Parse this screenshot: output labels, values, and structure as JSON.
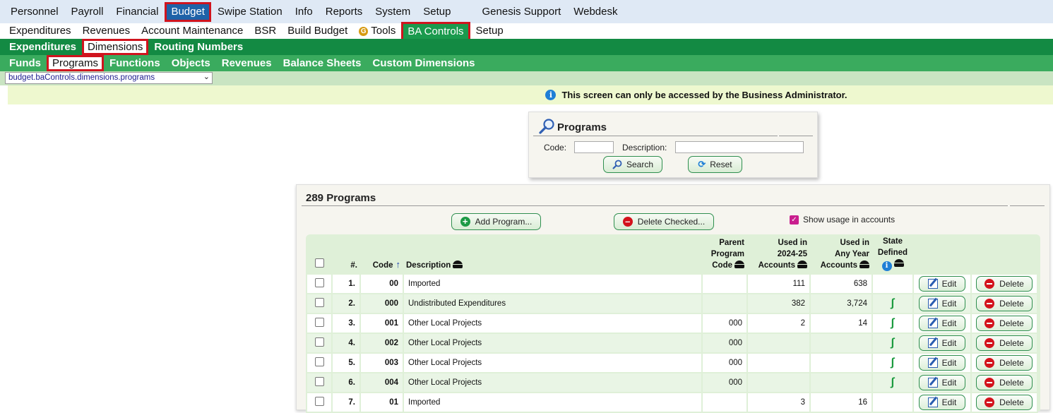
{
  "top_nav": {
    "items": [
      "Personnel",
      "Payroll",
      "Financial",
      "Budget",
      "Swipe Station",
      "Info",
      "Reports",
      "System",
      "Setup"
    ],
    "extra_items": [
      "Genesis Support",
      "Webdesk"
    ],
    "selected": "Budget"
  },
  "sub_nav": {
    "items": [
      "Expenditures",
      "Revenues",
      "Account Maintenance",
      "BSR",
      "Build Budget",
      "Tools",
      "BA Controls",
      "Setup"
    ],
    "selected": "BA Controls"
  },
  "nav3": {
    "items": [
      "Expenditures",
      "Dimensions",
      "Routing Numbers"
    ],
    "selected": "Dimensions"
  },
  "nav4": {
    "items": [
      "Funds",
      "Programs",
      "Functions",
      "Objects",
      "Revenues",
      "Balance Sheets",
      "Custom Dimensions"
    ],
    "selected": "Programs"
  },
  "screen_selector": {
    "value": "budget.baControls.dimensions.programs"
  },
  "info_message": "This screen can only be accessed by the Business Administrator.",
  "search_panel": {
    "title": "Programs",
    "code_label": "Code:",
    "code_value": "",
    "description_label": "Description:",
    "description_value": "",
    "search_label": "Search",
    "reset_label": "Reset"
  },
  "programs_panel": {
    "title": "289 Programs",
    "add_label": "Add Program...",
    "delete_checked_label": "Delete Checked...",
    "show_usage_label": "Show usage in accounts",
    "show_usage_checked": true,
    "columns": {
      "num": "#.",
      "code": "Code",
      "description": "Description",
      "parent_line1": "Parent",
      "parent_line2": "Program",
      "parent_line3": "Code",
      "used_year_line1": "Used in",
      "used_year_line2": "2024-25",
      "used_year_line3": "Accounts",
      "used_any_line1": "Used in",
      "used_any_line2": "Any Year",
      "used_any_line3": "Accounts",
      "state_line1": "State",
      "state_line2": "Defined"
    },
    "edit_label": "Edit",
    "delete_label": "Delete",
    "rows": [
      {
        "num": "1.",
        "code": "00",
        "description": "Imported",
        "parent": "",
        "used_year": "111",
        "used_any": "638",
        "state": false
      },
      {
        "num": "2.",
        "code": "000",
        "description": "Undistributed Expenditures",
        "parent": "",
        "used_year": "382",
        "used_any": "3,724",
        "state": true
      },
      {
        "num": "3.",
        "code": "001",
        "description": "Other Local Projects",
        "parent": "000",
        "used_year": "2",
        "used_any": "14",
        "state": true
      },
      {
        "num": "4.",
        "code": "002",
        "description": "Other Local Projects",
        "parent": "000",
        "used_year": "",
        "used_any": "",
        "state": true
      },
      {
        "num": "5.",
        "code": "003",
        "description": "Other Local Projects",
        "parent": "000",
        "used_year": "",
        "used_any": "",
        "state": true
      },
      {
        "num": "6.",
        "code": "004",
        "description": "Other Local Projects",
        "parent": "000",
        "used_year": "",
        "used_any": "",
        "state": true
      },
      {
        "num": "7.",
        "code": "01",
        "description": "Imported",
        "parent": "",
        "used_year": "3",
        "used_any": "16",
        "state": false
      }
    ]
  },
  "icons": {
    "g_logo": "G",
    "info": "i",
    "state": "new-jersey-state-icon"
  },
  "colors": {
    "top_nav_bg": "#dfe9f5",
    "top_nav_selected": "#1e62a8",
    "nav3_bg": "#138a43",
    "nav4_bg": "#3aab5e",
    "highlight_border": "#d0141e",
    "info_bg": "#eef8cf",
    "grid_bg": "#dff0d8"
  }
}
